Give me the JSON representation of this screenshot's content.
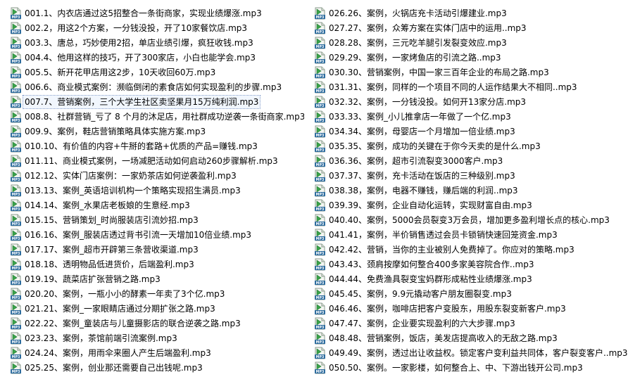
{
  "icon": "mp3-audio-file-icon",
  "accent": "#7a96c8",
  "left_files": [
    "001.1、内衣店通过这5招整合一条街商家，实现业绩爆涨.mp3",
    "002.2，用这2个方案，一分钱没投，开了10家餐饮店.mp3",
    "003.3、唐总，巧妙使用2招，单店业绩引爆，疯狂收钱.mp3",
    "004.4、他用这样的技巧，开了300家店，小白也能学会.mp3",
    "005.5、新开花甲店用这2步，10天收回60万.mp3",
    "006.6、商业模式案例：濒临倒闭的素食店如何实现盈利的步骤.mp3",
    "007.7、营销案例，三个大学生社区卖坚果月15万纯利润.mp3",
    "008.8、社群营销_亏了 8 个月的沐足店，用社群成功逆袭一条街商家.mp3",
    "009.9、案例，鞋店营销策略具体实施方案.mp3",
    "010.10、有价值的内容+牛掰的套路+优质的产品=赚钱.mp3",
    "011.11、商业模式案例，一场减肥活动如何启动260步骤解析.mp3",
    "012.12、实体门店案例：一家奶茶店如何逆袭盈利.mp3",
    "013.13、案例_英语培训机构一个策略实现招生满员.mp3",
    "014.14、案例_水果店老板娘的生意经.mp3",
    "015.15、营销策划_时尚服装店引流妙招.mp3",
    "016.16、案例_服装店透过背书引流一天增加10倍业绩.mp3",
    "017.17、案例_超市开辟第三条营收渠道.mp3",
    "018.18、透明物品低进货价，后端盈利.mp3",
    "019.19、蔬菜店扩张营销之路.mp3",
    "020.20、案例，一瓶小小的酵素一年卖了3个亿.mp3",
    "021.21、案例_一家眼睛店通过分期扩张之路.mp3",
    "022.22、案例_童装店与儿童摄影店的联合逆袭之路.mp3",
    "023.23、案例，茶馆前端引流案例.mp3",
    "024.24、案例，用雨伞来圈人产生后端盈利.mp3",
    "025.25、案例，创业那还需要自己出钱呢.mp3"
  ],
  "right_files": [
    "026.26、案例，火锅店充卡活动引爆建业.mp3",
    "027.27、案例，众筹方案在实体门店中的运用..mp3",
    "028.28、案例，三元吃羊腿引发裂变效应.mp3",
    "029.29、案例，一家烤鱼店的引流之路..mp3",
    "030.30、营销案例，中国一家三百年企业的布局之路.mp3",
    "031.31、案例，同样的一个项目不同的人运作结果大不相同..mp3",
    "032.32、案例，一分钱没投。如何开13家分店.mp3",
    "033.33、案例_小儿推拿店一年做了一个亿.mp3",
    "034.34、案例，母婴店一个月增加一倍业绩.mp3",
    "035.35、案例，成功的关键在于你今天卖的是什么.mp3",
    "036.36、案例，超市引流裂变3000客户.mp3",
    "037.37、案例，充卡活动在饭店的三种级别.mp3",
    "038.38，案例，电器不赚钱，赚后端的利润..mp3",
    "039.39、案例，企业自动化运转，实现财富自由.mp3",
    "040.40、案例，5000会员裂变3万会员，增加更多盈利增长点的核心.mp3",
    "041.41，案例，半价销售透过会员卡锁销快速回笼资金.mp3",
    "042.42、营销，当你的主业被别人免费掉了。你应对的策略.mp3",
    "043.43、颈肩按摩如何整合400多家美容院合作..mp3",
    "044.44、免费渔具裂变宝妈群形成粘性业绩爆涨.mp3",
    "045.45、案例，9.9元撬动客户朋友圈裂变.mp3",
    "046.46、案例，咖啡店把客户变股东，用股东裂变新客户.mp3",
    "047.47、案例，企业要实现盈利的六大步骤.mp3",
    "048.48、营销案例，饭店，美发店提高收入的无敌之路.mp3",
    "049.49、案例，透过出让收益权。锁定客户变利益共同体，客户裂变客户..mp3",
    "050.50、案例。一家影楼，如何整合上、中、下游出钱开公司.mp3"
  ]
}
